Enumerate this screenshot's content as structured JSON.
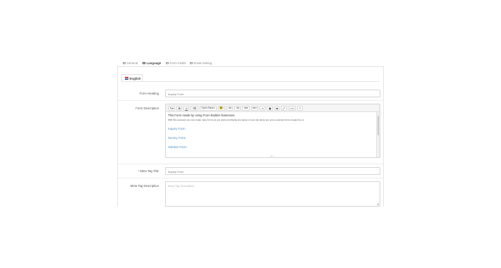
{
  "tabs": [
    {
      "label": "General",
      "icon": "cog-icon"
    },
    {
      "label": "Language",
      "icon": "flag-icon"
    },
    {
      "label": "Form Fields",
      "icon": "list-icon"
    },
    {
      "label": "Email Setting",
      "icon": "envelope-icon"
    }
  ],
  "language_tab": {
    "label": "English"
  },
  "form": {
    "heading_label": "Form Heading",
    "heading_value": "Inquiry Form",
    "description_label": "Form Description",
    "meta_title_label": "Meta Tag Title",
    "meta_title_required": "*",
    "meta_title_value": "Inquiry Form",
    "meta_description_label": "Meta Tag Description",
    "meta_description_placeholder": "Meta Tag Description"
  },
  "editor": {
    "toolbar": {
      "font_family": "Open Sans",
      "bold": "B",
      "underline": "U",
      "highlight": "A",
      "code": "</>",
      "help": "?"
    },
    "content": {
      "title": "This Form made by using Form Builder Extension.",
      "description": "With this extension you can create many forms as you want and display any layout of your site below are some example forms created by us.",
      "links": [
        "Inquiry Form",
        "Survey Form",
        "Sidebar Form"
      ]
    }
  },
  "colors": {
    "link": "#4a8fc7",
    "required": "#d9534f",
    "highlight": "#f2d23c"
  }
}
